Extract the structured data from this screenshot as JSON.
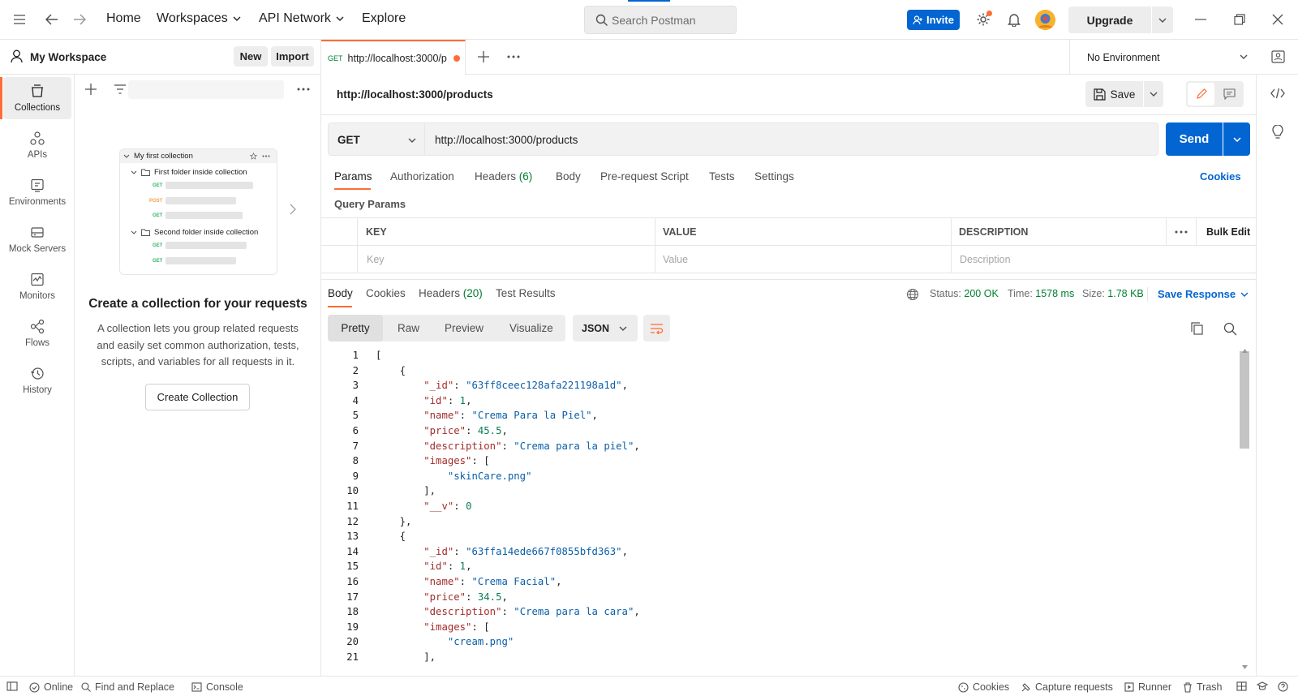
{
  "topbar": {
    "nav": [
      "Home",
      "Workspaces",
      "API Network",
      "Explore"
    ],
    "search_placeholder": "Search Postman",
    "invite": "Invite",
    "upgrade": "Upgrade"
  },
  "workspace": {
    "name": "My Workspace",
    "new": "New",
    "import": "Import"
  },
  "sidebar": {
    "items": [
      {
        "label": "Collections",
        "icon": "collections-icon"
      },
      {
        "label": "APIs",
        "icon": "apis-icon"
      },
      {
        "label": "Environments",
        "icon": "environments-icon"
      },
      {
        "label": "Mock Servers",
        "icon": "mock-servers-icon"
      },
      {
        "label": "Monitors",
        "icon": "monitors-icon"
      },
      {
        "label": "Flows",
        "icon": "flows-icon"
      },
      {
        "label": "History",
        "icon": "history-icon"
      }
    ]
  },
  "illustration": {
    "collection": "My first collection",
    "folder1": "First folder inside collection",
    "folder2": "Second folder inside collection",
    "get": "GET",
    "post": "POST"
  },
  "empty_state": {
    "title": "Create a collection for your requests",
    "body": "A collection lets you group related requests and easily set common authorization, tests, scripts, and variables for all requests in it.",
    "button": "Create Collection"
  },
  "tab": {
    "method": "GET",
    "title": "http://localhost:3000/p"
  },
  "environment": "No Environment",
  "request": {
    "name": "http://localhost:3000/products",
    "save": "Save",
    "method": "GET",
    "url": "http://localhost:3000/products",
    "send": "Send"
  },
  "request_tabs": {
    "params": "Params",
    "authorization": "Authorization",
    "headers": "Headers",
    "headers_count": "(6)",
    "body": "Body",
    "prerequest": "Pre-request Script",
    "tests": "Tests",
    "settings": "Settings",
    "cookies": "Cookies"
  },
  "query_params": {
    "title": "Query Params",
    "columns": [
      "KEY",
      "VALUE",
      "DESCRIPTION"
    ],
    "bulk_edit": "Bulk Edit",
    "placeholders": [
      "Key",
      "Value",
      "Description"
    ]
  },
  "response": {
    "tabs": {
      "body": "Body",
      "cookies": "Cookies",
      "headers": "Headers",
      "headers_count": "(20)",
      "test_results": "Test Results"
    },
    "status_label": "Status:",
    "status": "200 OK",
    "time_label": "Time:",
    "time": "1578 ms",
    "size_label": "Size:",
    "size": "1.78 KB",
    "save_response": "Save Response",
    "views": [
      "Pretty",
      "Raw",
      "Preview",
      "Visualize"
    ],
    "format": "JSON"
  },
  "code_lines": [
    [
      {
        "t": "["
      }
    ],
    [
      {
        "t": "    {"
      }
    ],
    [
      {
        "t": "        "
      },
      {
        "t": "\"_id\"",
        "c": "k"
      },
      {
        "t": ": "
      },
      {
        "t": "\"63ff8ceec128afa221198a1d\"",
        "c": "s"
      },
      {
        "t": ","
      }
    ],
    [
      {
        "t": "        "
      },
      {
        "t": "\"id\"",
        "c": "k"
      },
      {
        "t": ": "
      },
      {
        "t": "1",
        "c": "n"
      },
      {
        "t": ","
      }
    ],
    [
      {
        "t": "        "
      },
      {
        "t": "\"name\"",
        "c": "k"
      },
      {
        "t": ": "
      },
      {
        "t": "\"Crema Para la Piel\"",
        "c": "s"
      },
      {
        "t": ","
      }
    ],
    [
      {
        "t": "        "
      },
      {
        "t": "\"price\"",
        "c": "k"
      },
      {
        "t": ": "
      },
      {
        "t": "45.5",
        "c": "n"
      },
      {
        "t": ","
      }
    ],
    [
      {
        "t": "        "
      },
      {
        "t": "\"description\"",
        "c": "k"
      },
      {
        "t": ": "
      },
      {
        "t": "\"Crema para la piel\"",
        "c": "s"
      },
      {
        "t": ","
      }
    ],
    [
      {
        "t": "        "
      },
      {
        "t": "\"images\"",
        "c": "k"
      },
      {
        "t": ": ["
      }
    ],
    [
      {
        "t": "            "
      },
      {
        "t": "\"skinCare.png\"",
        "c": "s"
      }
    ],
    [
      {
        "t": "        ],"
      }
    ],
    [
      {
        "t": "        "
      },
      {
        "t": "\"__v\"",
        "c": "k"
      },
      {
        "t": ": "
      },
      {
        "t": "0",
        "c": "n"
      }
    ],
    [
      {
        "t": "    },"
      }
    ],
    [
      {
        "t": "    {"
      }
    ],
    [
      {
        "t": "        "
      },
      {
        "t": "\"_id\"",
        "c": "k"
      },
      {
        "t": ": "
      },
      {
        "t": "\"63ffa14ede667f0855bfd363\"",
        "c": "s"
      },
      {
        "t": ","
      }
    ],
    [
      {
        "t": "        "
      },
      {
        "t": "\"id\"",
        "c": "k"
      },
      {
        "t": ": "
      },
      {
        "t": "1",
        "c": "n"
      },
      {
        "t": ","
      }
    ],
    [
      {
        "t": "        "
      },
      {
        "t": "\"name\"",
        "c": "k"
      },
      {
        "t": ": "
      },
      {
        "t": "\"Crema Facial\"",
        "c": "s"
      },
      {
        "t": ","
      }
    ],
    [
      {
        "t": "        "
      },
      {
        "t": "\"price\"",
        "c": "k"
      },
      {
        "t": ": "
      },
      {
        "t": "34.5",
        "c": "n"
      },
      {
        "t": ","
      }
    ],
    [
      {
        "t": "        "
      },
      {
        "t": "\"description\"",
        "c": "k"
      },
      {
        "t": ": "
      },
      {
        "t": "\"Crema para la cara\"",
        "c": "s"
      },
      {
        "t": ","
      }
    ],
    [
      {
        "t": "        "
      },
      {
        "t": "\"images\"",
        "c": "k"
      },
      {
        "t": ": ["
      }
    ],
    [
      {
        "t": "            "
      },
      {
        "t": "\"cream.png\"",
        "c": "s"
      }
    ],
    [
      {
        "t": "        ],"
      }
    ]
  ],
  "statusbar": {
    "online": "Online",
    "find_replace": "Find and Replace",
    "console": "Console",
    "cookies": "Cookies",
    "capture": "Capture requests",
    "runner": "Runner",
    "trash": "Trash"
  },
  "colors": {
    "accent": "#ff6c37",
    "primary": "#0265d2",
    "success": "#007f31"
  }
}
